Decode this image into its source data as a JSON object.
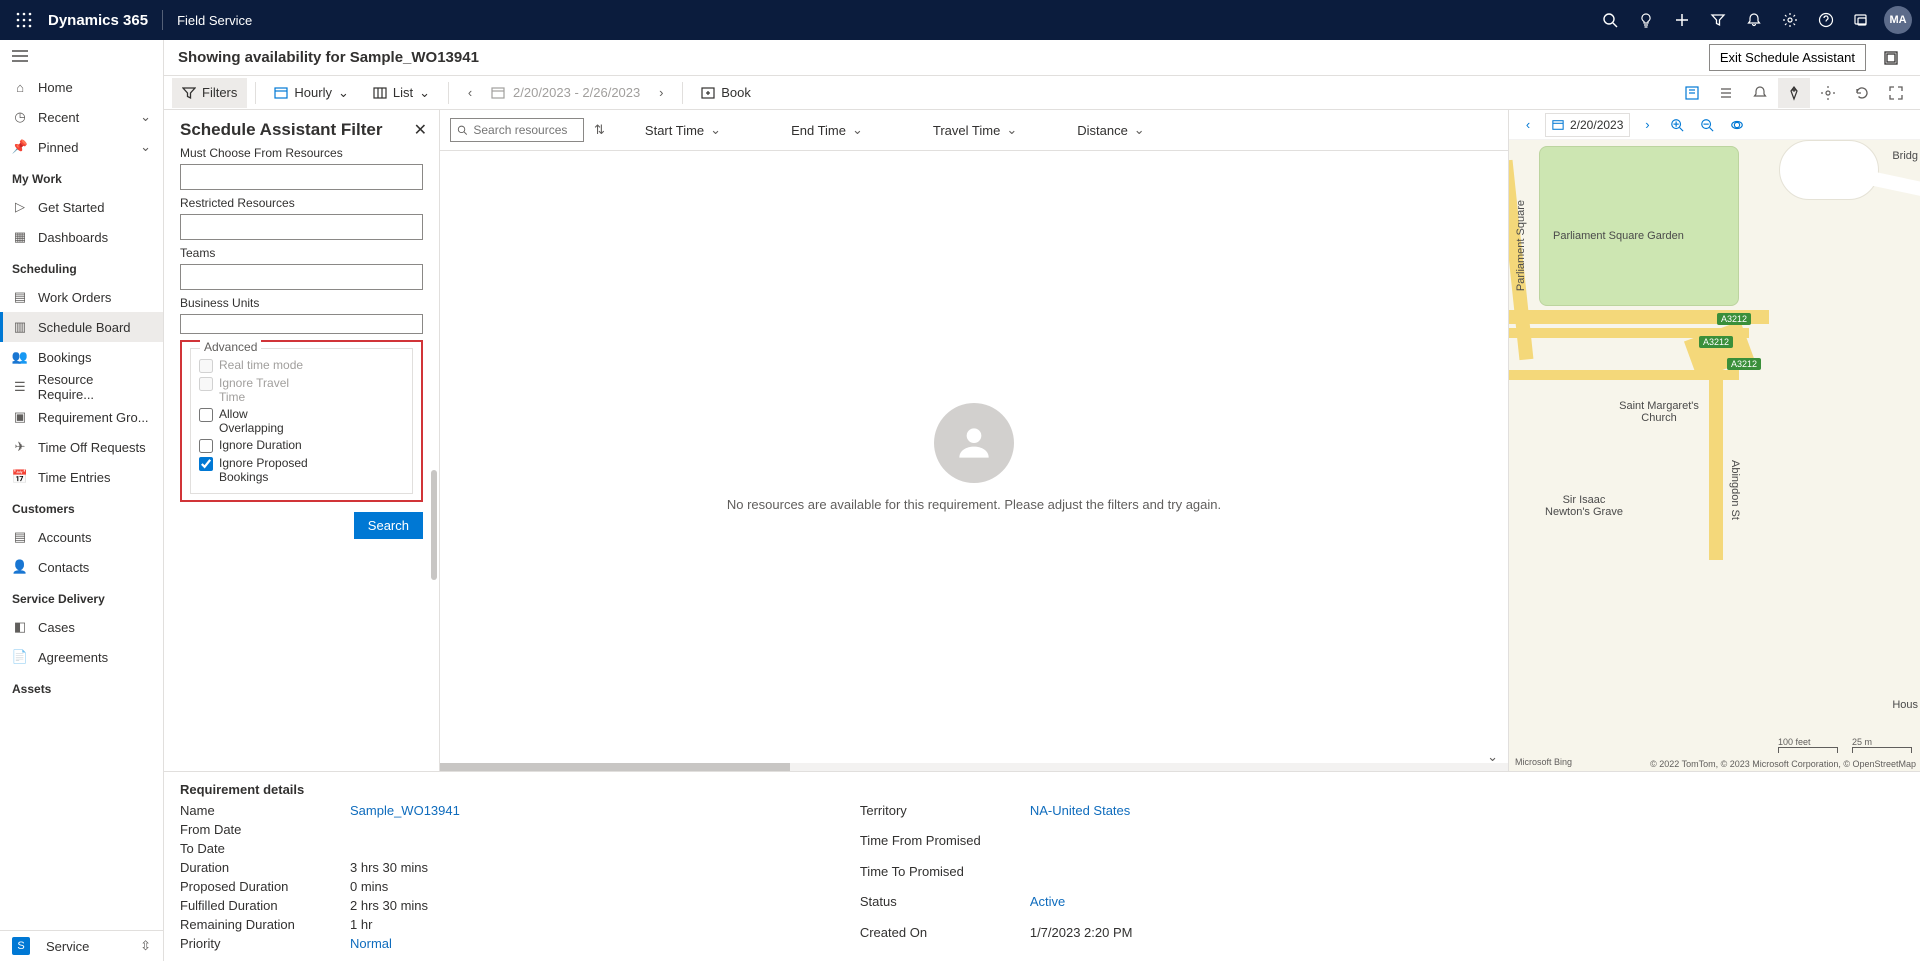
{
  "navbar": {
    "brand": "Dynamics 365",
    "app": "Field Service",
    "avatar_initials": "MA"
  },
  "leftnav": {
    "home": "Home",
    "recent": "Recent",
    "pinned": "Pinned",
    "sections": {
      "mywork": "My Work",
      "scheduling": "Scheduling",
      "customers": "Customers",
      "service_delivery": "Service Delivery",
      "assets": "Assets"
    },
    "items": {
      "get_started": "Get Started",
      "dashboards": "Dashboards",
      "work_orders": "Work Orders",
      "schedule_board": "Schedule Board",
      "bookings": "Bookings",
      "resource_req": "Resource Require...",
      "requirement_gro": "Requirement Gro...",
      "time_off": "Time Off Requests",
      "time_entries": "Time Entries",
      "accounts": "Accounts",
      "contacts": "Contacts",
      "cases": "Cases",
      "agreements": "Agreements"
    },
    "footer": {
      "badge": "S",
      "label": "Service"
    }
  },
  "page_header": {
    "title": "Showing availability for Sample_WO13941",
    "exit": "Exit Schedule Assistant"
  },
  "cmdbar": {
    "filters": "Filters",
    "hourly": "Hourly",
    "list": "List",
    "date_range": "2/20/2023 - 2/26/2023",
    "book": "Book"
  },
  "filter_panel": {
    "title": "Schedule Assistant Filter",
    "must_choose": "Must Choose From Resources",
    "restricted": "Restricted Resources",
    "teams": "Teams",
    "business_units": "Business Units",
    "advanced": "Advanced",
    "real_time": "Real time mode",
    "ignore_travel": "Ignore Travel Time",
    "allow_overlap": "Allow Overlapping",
    "ignore_duration": "Ignore Duration",
    "ignore_proposed": "Ignore Proposed Bookings",
    "search": "Search"
  },
  "center": {
    "search_placeholder": "Search resources",
    "columns": {
      "start": "Start Time",
      "end": "End Time",
      "travel": "Travel Time",
      "distance": "Distance"
    },
    "empty_text": "No resources are available for this requirement. Please adjust the filters and try again."
  },
  "map": {
    "date": "2/20/2023",
    "labels": {
      "parliament_square": "Parliament Square",
      "parliament_garden": "Parliament Square Garden",
      "st_margaret": "Saint Margaret's Church",
      "newton": "Sir Isaac Newton's Grave",
      "abingdon": "Abingdon St",
      "bridg": "Bridg",
      "hous": "Hous"
    },
    "road_badge": "A3212",
    "scale1": "100 feet",
    "scale2": "25 m",
    "bing": "Microsoft Bing",
    "attribution": "© 2022 TomTom, © 2023 Microsoft Corporation, © OpenStreetMap"
  },
  "requirement": {
    "heading": "Requirement details",
    "left": {
      "name_label": "Name",
      "name_value": "Sample_WO13941",
      "from_date_label": "From Date",
      "to_date_label": "To Date",
      "duration_label": "Duration",
      "duration_value": "3 hrs 30 mins",
      "proposed_label": "Proposed Duration",
      "proposed_value": "0 mins",
      "fulfilled_label": "Fulfilled Duration",
      "fulfilled_value": "2 hrs 30 mins",
      "remaining_label": "Remaining Duration",
      "remaining_value": "1 hr",
      "priority_label": "Priority",
      "priority_value": "Normal"
    },
    "right": {
      "territory_label": "Territory",
      "territory_value": "NA-United States",
      "tfp_label": "Time From Promised",
      "ttp_label": "Time To Promised",
      "status_label": "Status",
      "status_value": "Active",
      "created_label": "Created On",
      "created_value": "1/7/2023 2:20 PM"
    }
  }
}
